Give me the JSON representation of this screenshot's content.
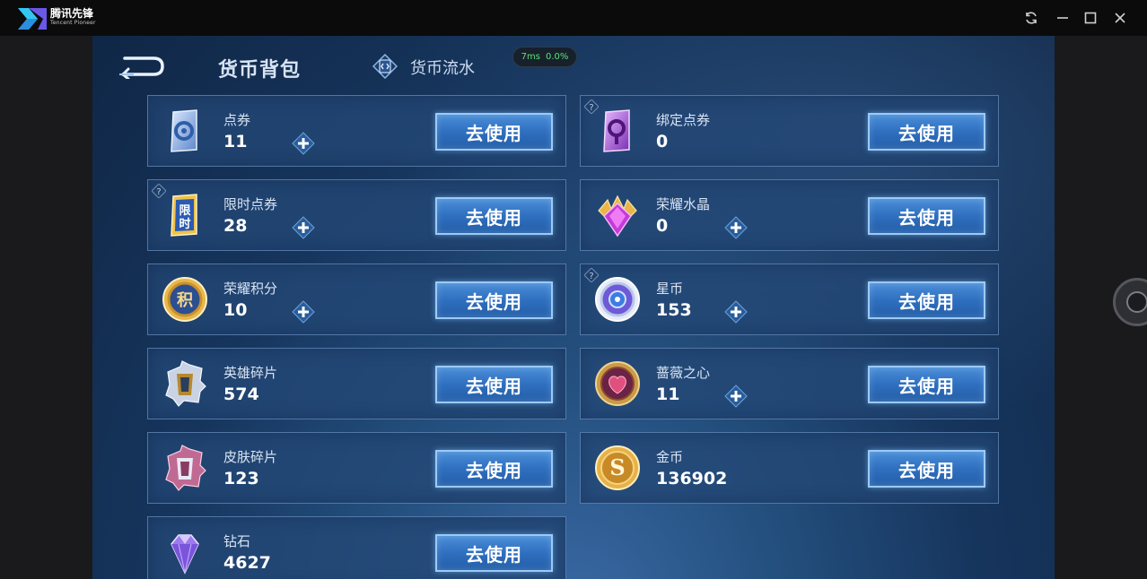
{
  "host": {
    "brand_cn": "腾讯先锋",
    "brand_en": "Tencent Pioneer"
  },
  "header": {
    "title": "货币背包",
    "flow_label": "货币流水",
    "ping_ms": "7ms",
    "ping_loss": "0.0%"
  },
  "cards": [
    {
      "name": "点券",
      "value": "11",
      "button": "去使用"
    },
    {
      "name": "绑定点券",
      "value": "0",
      "button": "去使用"
    },
    {
      "name": "限时点券",
      "value": "28",
      "button": "去使用"
    },
    {
      "name": "荣耀水晶",
      "value": "0",
      "button": "去使用"
    },
    {
      "name": "荣耀积分",
      "value": "10",
      "button": "去使用"
    },
    {
      "name": "星币",
      "value": "153",
      "button": "去使用"
    },
    {
      "name": "英雄碎片",
      "value": "574",
      "button": "去使用"
    },
    {
      "name": "蔷薇之心",
      "value": "11",
      "button": "去使用"
    },
    {
      "name": "皮肤碎片",
      "value": "123",
      "button": "去使用"
    },
    {
      "name": "金币",
      "value": "136902",
      "button": "去使用"
    },
    {
      "name": "钻石",
      "value": "4627",
      "button": "去使用"
    }
  ],
  "icon_names": [
    "voucher-icon",
    "bound-voucher-icon",
    "limited-voucher-icon",
    "glory-crystal-icon",
    "glory-points-icon",
    "star-coin-icon",
    "hero-fragment-icon",
    "rose-heart-icon",
    "skin-fragment-icon",
    "gold-coin-icon",
    "diamond-icon"
  ]
}
